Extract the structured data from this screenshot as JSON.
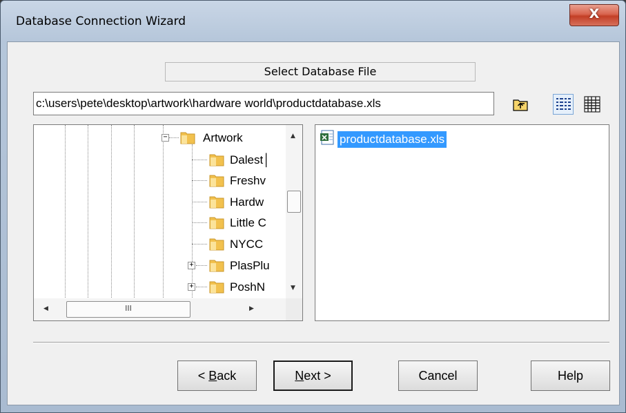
{
  "window": {
    "title": "Database Connection Wizard",
    "close_glyph": "X"
  },
  "section_label": "Select Database File",
  "path_field": {
    "value": "c:\\users\\pete\\desktop\\artwork\\hardware world\\productdatabase.xls"
  },
  "toolbar": {
    "up_icon": "folder-up-icon",
    "details_icon": "details-view-icon",
    "list_icon": "list-view-icon"
  },
  "tree": {
    "items": [
      {
        "label": "Artwork",
        "expander": "−"
      },
      {
        "label": "Dalest│"
      },
      {
        "label": "Freshv"
      },
      {
        "label": "Hardw"
      },
      {
        "label": "Little C"
      },
      {
        "label": "NYCC"
      },
      {
        "label": "PlasPlu",
        "expander": "+"
      },
      {
        "label": "PoshN",
        "expander": "+"
      }
    ],
    "hscroll_thumb": "III"
  },
  "files": [
    {
      "name": "productdatabase.xls",
      "selected": true
    }
  ],
  "buttons": {
    "back": {
      "prefix": "< ",
      "mnemonic": "B",
      "rest": "ack"
    },
    "next": {
      "mnemonic": "N",
      "rest": "ext >"
    },
    "cancel": "Cancel",
    "help": "Help"
  },
  "colors": {
    "selection": "#3399ff",
    "folder": "#f2c14e"
  }
}
